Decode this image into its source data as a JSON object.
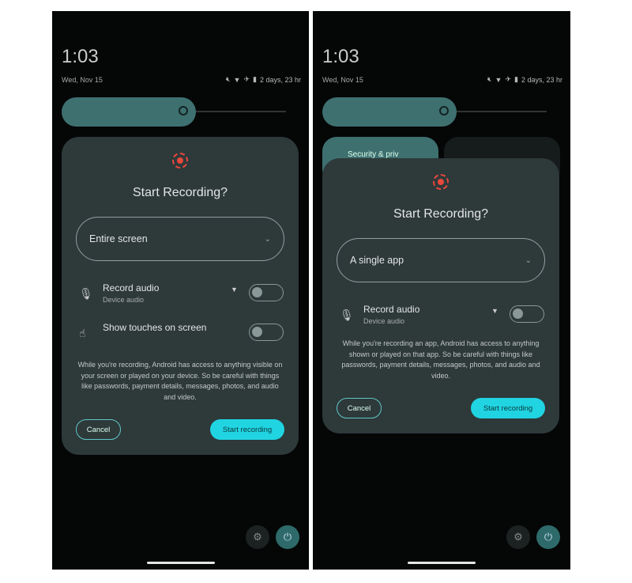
{
  "accent_color": "#20d4e2",
  "record_icon_color": "#e8473c",
  "screens": [
    {
      "time": "1:03",
      "date": "Wed, Nov 15",
      "battery": "2 days, 23 hr",
      "status_icons": [
        "mute-icon",
        "wifi-icon",
        "airplane-icon",
        "battery-icon"
      ],
      "dialog": {
        "title": "Start Recording?",
        "select_value": "Entire screen",
        "record_audio_label": "Record audio",
        "record_audio_sub": "Device audio",
        "record_audio_on": false,
        "show_touches_label": "Show touches on screen",
        "show_touches_on": false,
        "warning": "While you're recording, Android has access to anything visible on your screen or played on your device. So be careful with things like passwords, payment details, messages, photos, and audio and video.",
        "cancel": "Cancel",
        "start": "Start recording"
      }
    },
    {
      "time": "1:03",
      "date": "Wed, Nov 15",
      "battery": "2 days, 23 hr",
      "status_icons": [
        "mute-icon",
        "wifi-icon",
        "airplane-icon",
        "battery-icon"
      ],
      "tile_label": "Security & priv",
      "dialog": {
        "title": "Start Recording?",
        "select_value": "A single app",
        "record_audio_label": "Record audio",
        "record_audio_sub": "Device audio",
        "record_audio_on": false,
        "warning": "While you're recording an app, Android has access to anything shown or played on that app. So be careful with things like passwords, payment details, messages, photos, and audio and video.",
        "cancel": "Cancel",
        "start": "Start recording"
      }
    }
  ]
}
